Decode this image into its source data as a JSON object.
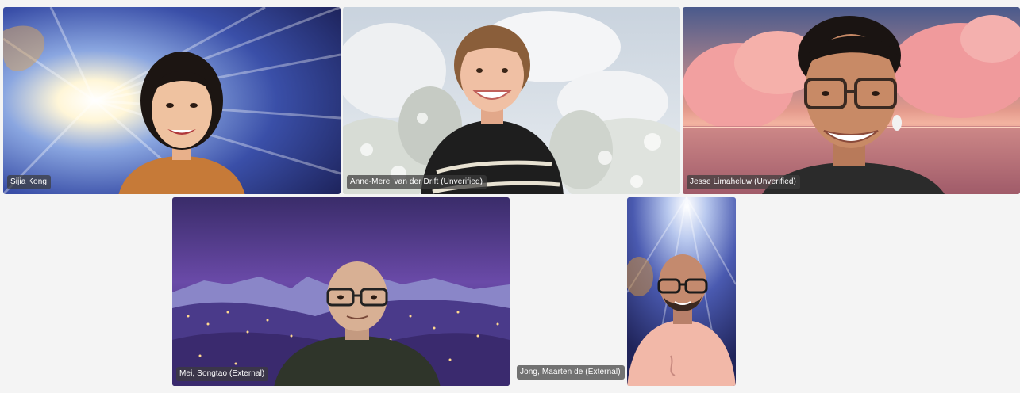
{
  "participants": [
    {
      "name": "Sijia Kong",
      "background": "light-burst"
    },
    {
      "name": "Anne-Merel van der Drift (Unverified)",
      "background": "clouds-snowy-trees"
    },
    {
      "name": "Jesse Limaheluw (Unverified)",
      "background": "pink-clouds-sunset-sea"
    },
    {
      "name": "Mei, Songtao (External)",
      "background": "purple-night-hills"
    },
    {
      "name": "Jong, Maarten de (External)",
      "background": "light-burst"
    }
  ],
  "colors": {
    "stage_bg": "#f4f4f4",
    "nametag_bg": "#3c3c3c",
    "nametag_text": "#ffffff"
  }
}
